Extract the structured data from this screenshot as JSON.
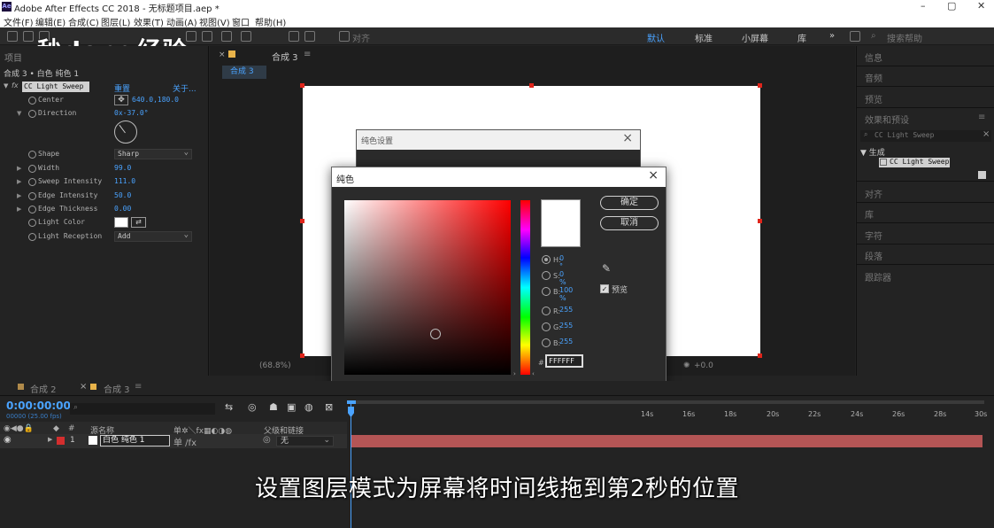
{
  "window": {
    "title": "Adobe After Effects CC 2018 - 无标题项目.aep *",
    "logo": "Ae",
    "minimize": "–",
    "maximize": "▢",
    "close": "✕"
  },
  "menu": [
    "文件(F)",
    "编辑(E)",
    "合成(C)",
    "图层(L)",
    "效果(T)",
    "动画(A)",
    "视图(V)",
    "窗口",
    "帮助(H)"
  ],
  "toolbar": {
    "snap_label": "对齐",
    "workspaces": [
      "默认",
      "标准",
      "小屏幕",
      "库"
    ],
    "search_placeholder": "搜索帮助",
    "more": "»"
  },
  "watermark": "秒dong经验",
  "effects_panel": {
    "tab_project": "项目",
    "breadcrumb": "合成 3 • 白色 纯色 1",
    "effect_name": "CC Light Sweep",
    "reset": "重置",
    "about": "关于...",
    "props": {
      "center": {
        "label": "Center",
        "value": "640.0,180.0"
      },
      "direction": {
        "label": "Direction",
        "value": "0x-37.0°"
      },
      "shape": {
        "label": "Shape",
        "value": "Sharp"
      },
      "width": {
        "label": "Width",
        "value": "99.0"
      },
      "sweep": {
        "label": "Sweep Intensity",
        "value": "111.0"
      },
      "edge": {
        "label": "Edge Intensity",
        "value": "50.0"
      },
      "thick": {
        "label": "Edge Thickness",
        "value": "0.00"
      },
      "color": {
        "label": "Light Color"
      },
      "reception": {
        "label": "Light Reception",
        "value": "Add"
      }
    }
  },
  "viewer": {
    "tab": "合成 3",
    "subtab": "合成 3",
    "zoom": "(68.8%)",
    "exposure": "+0.0"
  },
  "right_panel": {
    "info": "信息",
    "audio": "音频",
    "preview": "预览",
    "effects_presets": "效果和预设",
    "search_value": "CC Light Sweep",
    "group": "生成",
    "item": "CC Light Sweep",
    "align": "对齐",
    "library": "库",
    "char": "字符",
    "para": "段落",
    "tracker": "跟踪器"
  },
  "solid_dialog": {
    "title": "纯色设置",
    "preview": "预览",
    "ok": "确定",
    "cancel": "取消"
  },
  "color_dialog": {
    "title": "纯色",
    "ok": "确定",
    "cancel": "取消",
    "preview": "预览",
    "h": {
      "k": "H:",
      "v": "0 °"
    },
    "s": {
      "k": "S:",
      "v": "0 %"
    },
    "b": {
      "k": "B:",
      "v": "100 %"
    },
    "r": {
      "k": "R:",
      "v": "255"
    },
    "g": {
      "k": "G:",
      "v": "255"
    },
    "bb": {
      "k": "B:",
      "v": "255"
    },
    "hash": "#",
    "hex": "FFFFFF",
    "color": "#ffffff"
  },
  "timeline": {
    "tab1": "合成 2",
    "tab2": "合成 3",
    "timecode": "0:00:00:00",
    "fps": "00000 (25.00 fps)",
    "col_num": "#",
    "col_source": "源名称",
    "col_parent": "父级和链接",
    "layer_num": "1",
    "layer_name": "白色 纯色 1",
    "parent_value": "无",
    "ticks": [
      "14s",
      "16s",
      "18s",
      "20s",
      "22s",
      "24s",
      "26s",
      "28s",
      "30s"
    ]
  },
  "caption": "设置图层模式为屏幕将时间线拖到第2秒的位置"
}
